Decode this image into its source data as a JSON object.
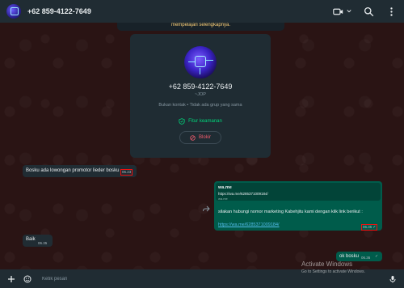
{
  "header": {
    "title": "+62 859-4122-7649",
    "icons": [
      "video-icon",
      "chevron-down-icon",
      "search-icon",
      "more-icon"
    ]
  },
  "banner": {
    "text": "mempelajari selengkapnya."
  },
  "profile": {
    "phone": "+62 859-4122-7649",
    "name": "~JOP",
    "subtitle": "Bukan kontak • Tidak ada grup yang sama",
    "security_label": "Fitur keamanan",
    "block_label": "Blokir"
  },
  "messages": {
    "m1": {
      "text": "Bosku ada lowongan promotor lieder bosku",
      "time": "06.23"
    },
    "m2": {
      "preview_title": "wa.me",
      "preview_url": "https://wa.me/6285371009184/",
      "preview_domain": "wa.me",
      "body": "silakan hubungi nomor marketing Kabehjitu kami dengan klik link berikut :",
      "link": "https://wa.me/6285371009184/",
      "time": "06.35"
    },
    "m3": {
      "text": "Baik",
      "time": "06.35"
    },
    "m4": {
      "text": "ok bosku",
      "time": "06.36"
    }
  },
  "footer": {
    "placeholder": "Ketik pesan"
  },
  "watermark": {
    "title": "Activate Windows",
    "subtitle": "Go to Settings to activate Windows."
  },
  "colors": {
    "header_bg": "#202c33",
    "incoming_bg": "#202c33",
    "outgoing_bg": "#005c4b",
    "accent_green": "#00d47a",
    "danger": "#f15c6d",
    "link": "#53bdeb"
  }
}
